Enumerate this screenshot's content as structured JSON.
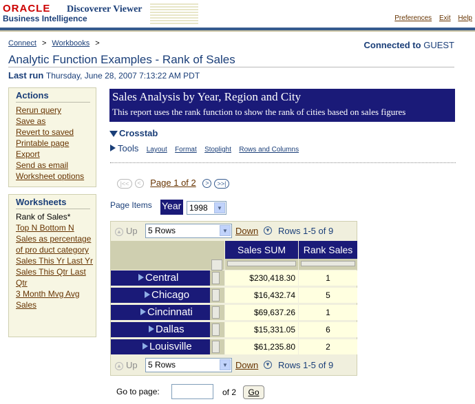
{
  "header": {
    "oracle_logo": "ORACLE",
    "product": "Discoverer Viewer",
    "subproduct": "Business Intelligence",
    "links": [
      "Preferences",
      "Exit",
      "Help"
    ]
  },
  "breadcrumb": [
    "Connect",
    "Workbooks"
  ],
  "connected": {
    "label": "Connected to",
    "user": "GUEST"
  },
  "page_title": "Analytic Function Examples - Rank of Sales",
  "last_run": {
    "label": "Last run",
    "value": "Thursday, June 28, 2007 7:13:22 AM PDT"
  },
  "actions": {
    "title": "Actions",
    "items": [
      "Rerun query",
      "Save as",
      "Revert to saved",
      "Printable page",
      "Export",
      "Send as email",
      "Worksheet options"
    ]
  },
  "worksheets": {
    "title": "Worksheets",
    "items": [
      {
        "label": "Rank of Sales*",
        "current": true
      },
      {
        "label": "Top N Bottom N"
      },
      {
        "label": "Sales as percentage of pro duct category"
      },
      {
        "label": "Sales This Yr Last Yr"
      },
      {
        "label": "Sales This Qtr Last Qtr"
      },
      {
        "label": "3 Month Mvg Avg Sales"
      }
    ]
  },
  "report": {
    "title": "Sales Analysis by Year, Region and City",
    "description": "This report uses the rank function to show the rank of cities based on sales figures"
  },
  "crosstab": {
    "label": "Crosstab",
    "tools": "Tools",
    "tool_links": [
      "Layout",
      "Format",
      "Stoplight",
      "Rows and Columns"
    ]
  },
  "pager": {
    "page_label": "Page 1 of 2"
  },
  "page_items": {
    "label": "Page Items",
    "item": "Year",
    "value": "1998"
  },
  "nav": {
    "up": "Up",
    "rows_option": "5 Rows",
    "down": "Down",
    "range": "Rows 1-5 of 9"
  },
  "table": {
    "columns": [
      "Sales SUM",
      "Rank Sales"
    ],
    "rows": [
      {
        "city": "Central",
        "sum": "$230,418.30",
        "rank": "1"
      },
      {
        "city": "Chicago",
        "sum": "$16,432.74",
        "rank": "5"
      },
      {
        "city": "Cincinnati",
        "sum": "$69,637.26",
        "rank": "1"
      },
      {
        "city": "Dallas",
        "sum": "$15,331.05",
        "rank": "6"
      },
      {
        "city": "Louisville",
        "sum": "$61,235.80",
        "rank": "2"
      }
    ]
  },
  "goto": {
    "label": "Go to page:",
    "of": "of 2",
    "button": "Go"
  }
}
